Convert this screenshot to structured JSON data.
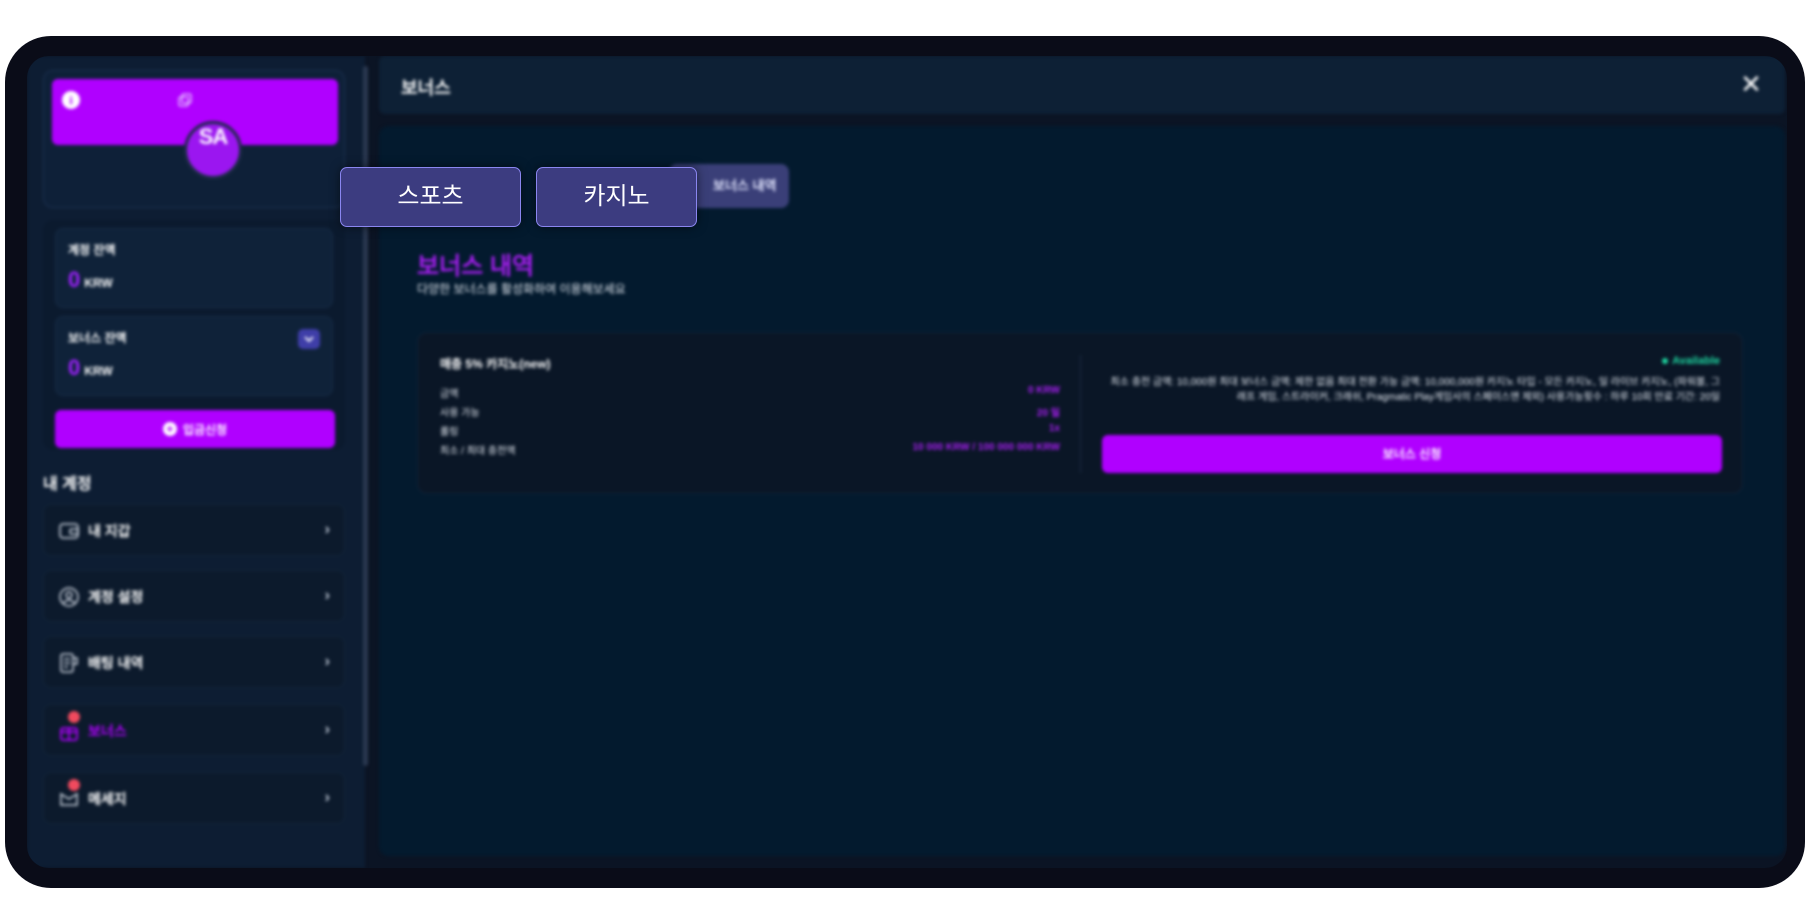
{
  "sidebar": {
    "profile": {
      "initials": "SA"
    },
    "wallet": {
      "account_balance_label": "계정 잔액",
      "account_balance_value": "0",
      "account_balance_unit": "KRW",
      "bonus_balance_label": "보너스 잔액",
      "bonus_balance_value": "0",
      "bonus_balance_unit": "KRW",
      "deposit_label": "입금신청"
    },
    "section_title": "내 계정",
    "items": [
      {
        "label": "내 지갑",
        "icon": "wallet-icon",
        "active": false
      },
      {
        "label": "계정 설정",
        "icon": "user-icon",
        "active": false
      },
      {
        "label": "배팅 내역",
        "icon": "receipt-icon",
        "active": false
      },
      {
        "label": "보너스",
        "icon": "gift-icon",
        "active": true
      },
      {
        "label": "메세지",
        "icon": "message-icon",
        "active": false
      }
    ]
  },
  "modal": {
    "title": "보너스",
    "close_symbol": "✕"
  },
  "tabs": {
    "sports": "스포츠",
    "casino": "카지노",
    "history": "보너스 내역"
  },
  "main": {
    "heading": "보너스 내역",
    "subheading": "다양한 보너스를 활성화하여 이용해보세요"
  },
  "bonus_card": {
    "name": "매충 5% 카지노(new)",
    "rows": [
      {
        "key": "금액",
        "value": "0 KRW"
      },
      {
        "key": "사용 가능",
        "value": "20 일"
      },
      {
        "key": "롤링",
        "value": "1x"
      },
      {
        "key": "최소 / 최대 충전액",
        "value": "10 000 KRW / 100 000 000 KRW"
      }
    ],
    "status": "Available",
    "description": "최소 충전 금액: 10,000원 최대 보너스 금액: 제한 없음 최대 전환 가능 금액: 10,000,000원 카지노 타입 - 모든 카지노, 일 라이브 카지노, (파워볼, 그래프 게임, 스트라이커, 크래쉬, Pragmatic Play게임사의 스페이스맨 제외) 사용가능횟수 : 하루 10회 만료 기간: 20일",
    "apply_label": "보너스 신청"
  },
  "colors": {
    "accent": "#b000ff",
    "available": "#1ed6a0",
    "background": "#031a2e"
  }
}
